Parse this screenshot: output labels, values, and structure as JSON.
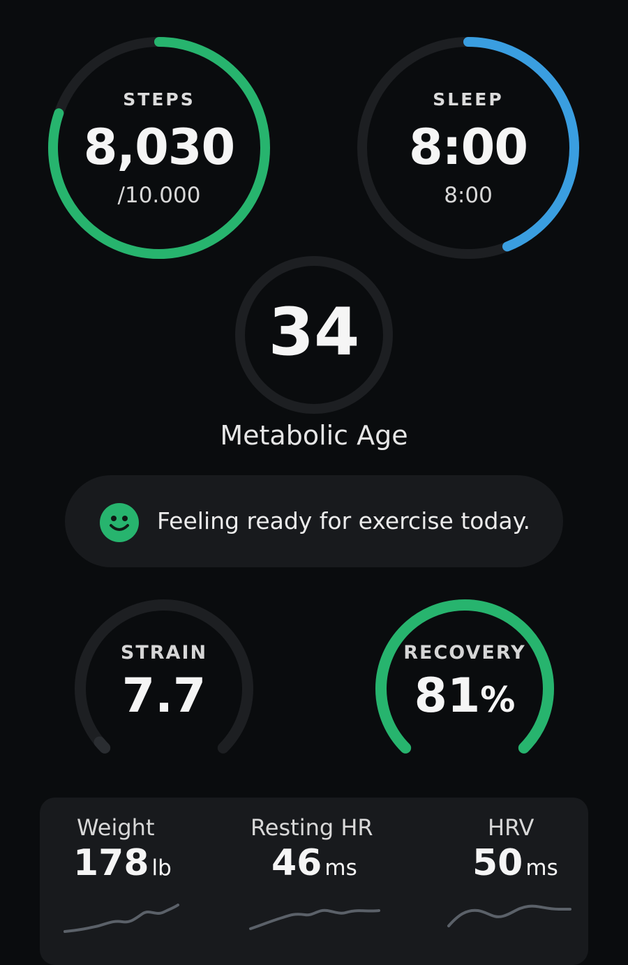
{
  "steps": {
    "label": "STEPS",
    "value": "8,030",
    "goal": "/10.000",
    "progress": 0.803,
    "color": "#27b46e"
  },
  "sleep": {
    "label": "SLEEP",
    "value": "8:00",
    "goal": "8:00",
    "progress": 0.44,
    "color": "#3a9ee0"
  },
  "metabolic_age": {
    "value": "34",
    "label": "Metabolic Age"
  },
  "readiness": {
    "icon": "smiley-face-icon",
    "message": "Feeling ready for exercise today.",
    "color": "#27b46e"
  },
  "strain": {
    "label": "STRAIN",
    "value": "7.7",
    "progress": 0.02
  },
  "recovery": {
    "label": "RECOVERY",
    "value": "81",
    "unit": "%",
    "progress": 1.0,
    "color": "#27b46e"
  },
  "stats": {
    "weight": {
      "label": "Weight",
      "value": "178",
      "unit": "lb"
    },
    "resting_hr": {
      "label": "Resting HR",
      "value": "46",
      "unit": "ms"
    },
    "hrv": {
      "label": "HRV",
      "value": "50",
      "unit": "ms"
    }
  },
  "colors": {
    "background": "#0a0c0e",
    "track": "#1d1f22",
    "card": "#181a1d",
    "sparkline": "#5b6169"
  }
}
